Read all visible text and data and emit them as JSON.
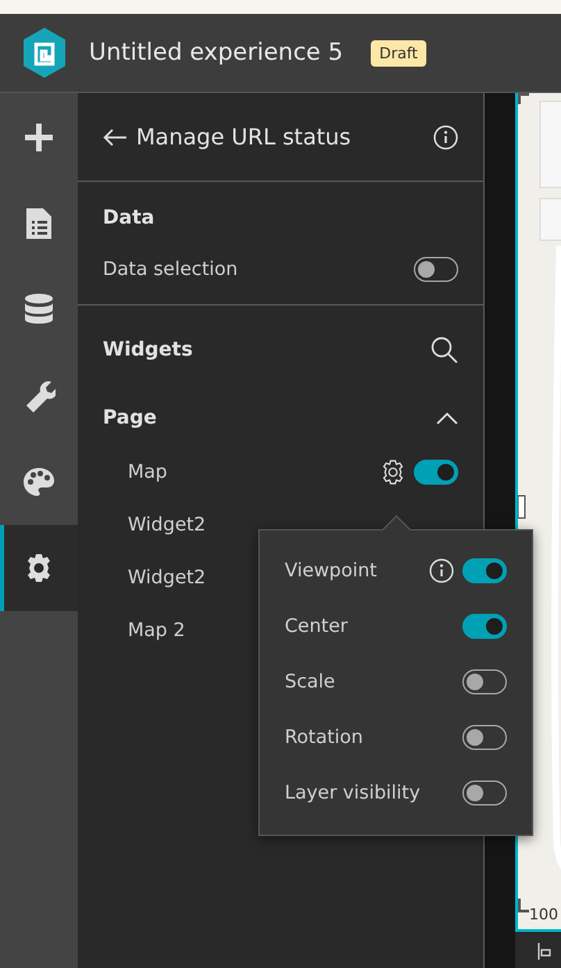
{
  "app": {
    "title": "Untitled experience 5",
    "badge": "Draft"
  },
  "rail": [
    {
      "selected": false
    },
    {
      "selected": false
    },
    {
      "selected": false
    },
    {
      "selected": false
    },
    {
      "selected": false
    },
    {
      "selected": true
    }
  ],
  "panel": {
    "title": "Manage URL status",
    "data": {
      "title": "Data",
      "items": [
        {
          "label": "Data selection",
          "on": false
        }
      ]
    },
    "widgets": {
      "title": "Widgets",
      "groups": [
        {
          "title": "Page",
          "expanded": true,
          "items": [
            {
              "label": "Map",
              "settings": true,
              "on": true
            },
            {
              "label": "Widget2",
              "settings": false
            },
            {
              "label": "Widget2",
              "settings": false
            },
            {
              "label": "Map 2",
              "settings": false
            }
          ]
        }
      ]
    }
  },
  "popover": {
    "items": [
      {
        "label": "Viewpoint",
        "info": true,
        "on": true
      },
      {
        "label": "Center",
        "info": false,
        "on": true
      },
      {
        "label": "Scale",
        "info": false,
        "on": false
      },
      {
        "label": "Rotation",
        "info": false,
        "on": false
      },
      {
        "label": "Layer visibility",
        "info": false,
        "on": false
      }
    ]
  },
  "map": {
    "scale": "100"
  }
}
